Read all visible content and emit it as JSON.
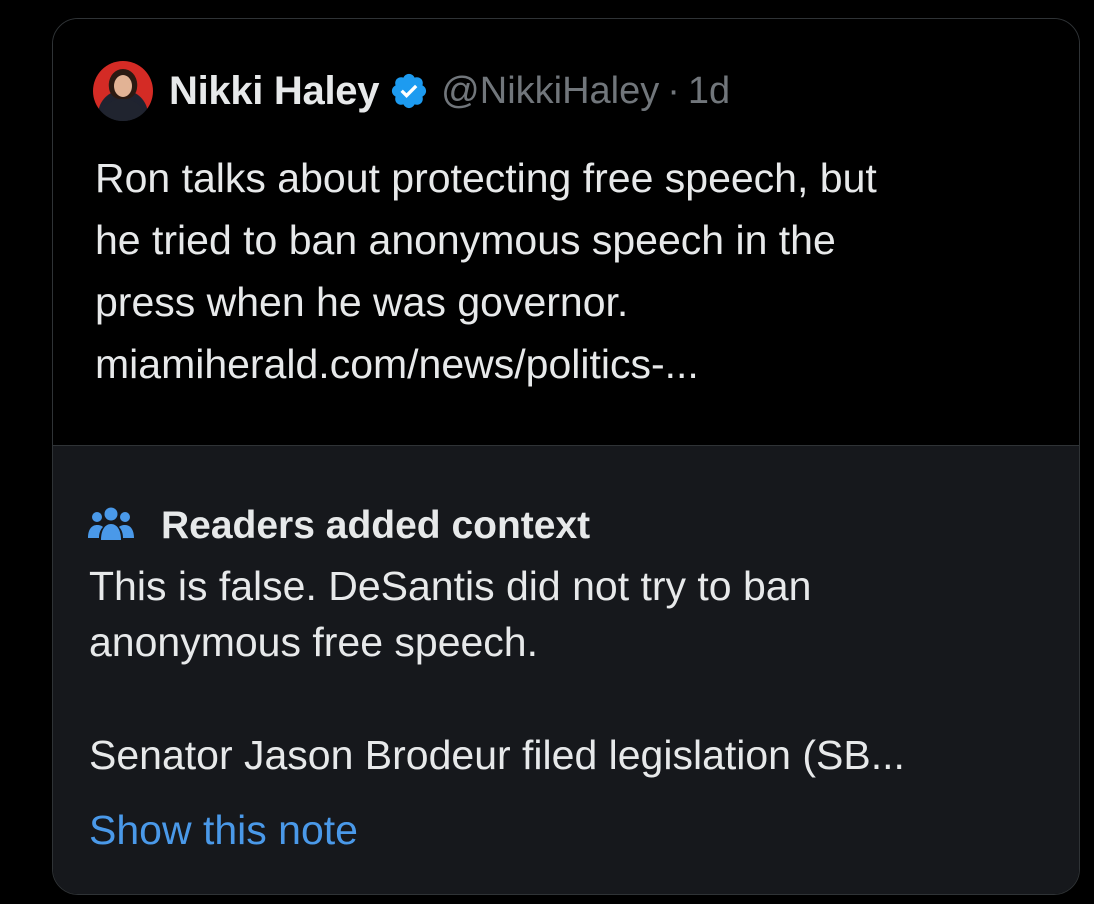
{
  "post": {
    "author_name": "Nikki Haley",
    "handle": "@NikkiHaley",
    "separator": "·",
    "time": "1d",
    "avatar_icon": "avatar-photo",
    "verified_icon": "verified-badge-icon",
    "text_lines": [
      "Ron talks about protecting free speech, but",
      "he tried to ban anonymous speech in the",
      "press when he was governor.",
      "miamiherald.com/news/politics-..."
    ]
  },
  "community_note": {
    "icon": "people-icon",
    "title": "Readers added context",
    "paragraph1_lines": [
      "This is false. DeSantis did not try to ban",
      "anonymous free speech."
    ],
    "paragraph2_lines": [
      "Senator Jason Brodeur filed legislation (SB..."
    ],
    "show_label": "Show this note"
  },
  "colors": {
    "background": "#000000",
    "note_background": "#16181c",
    "border": "#2f3336",
    "text_primary": "#e7e9ea",
    "text_secondary": "#71767b",
    "link": "#4a99e9",
    "verified": "#1d9bf0",
    "people_icon": "#4a99e9"
  }
}
